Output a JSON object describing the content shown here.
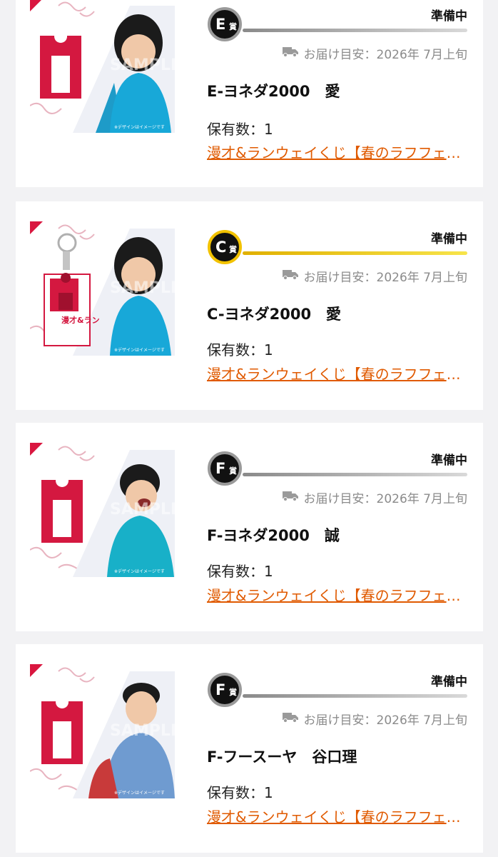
{
  "items": [
    {
      "rank": "E",
      "rank_suffix": "賞",
      "rank_color": "#9a9a9a",
      "status": "準備中",
      "delivery": "お届け目安：2026年 7月上旬",
      "title": "E-ヨネダ2000　愛",
      "quantity": "保有数：1",
      "lottery": "漫才&ランウェイくじ【春のラフフェス】",
      "image_icon": "acrylic-stand-image",
      "watermark": "SAMPLE",
      "image_caption": "※デザインはイメージです"
    },
    {
      "rank": "C",
      "rank_suffix": "賞",
      "rank_color": "#f2c200",
      "status": "準備中",
      "delivery": "お届け目安：2026年 7月上旬",
      "title": "C-ヨネダ2000　愛",
      "quantity": "保有数：1",
      "lottery": "漫才&ランウェイくじ【春のラフフェス】",
      "image_icon": "acrylic-keychain-image",
      "watermark": "SAMPLE",
      "image_caption": "※デザインはイメージです"
    },
    {
      "rank": "F",
      "rank_suffix": "賞",
      "rank_color": "#9a9a9a",
      "status": "準備中",
      "delivery": "お届け目安：2026年 7月上旬",
      "title": "F-ヨネダ2000　誠",
      "quantity": "保有数：1",
      "lottery": "漫才&ランウェイくじ【春のラフフェス】",
      "image_icon": "acrylic-stand-image",
      "watermark": "SAMPLE",
      "image_caption": "※デザインはイメージです"
    },
    {
      "rank": "F",
      "rank_suffix": "賞",
      "rank_color": "#9a9a9a",
      "status": "準備中",
      "delivery": "お届け目安：2026年 7月上旬",
      "title": "F-フースーヤ　谷口理",
      "quantity": "保有数：1",
      "lottery": "漫才&ランウェイくじ【春のラフフェス】",
      "image_icon": "acrylic-stand-image",
      "watermark": "SAMPLE",
      "image_caption": "※デザインはイメージです"
    }
  ]
}
